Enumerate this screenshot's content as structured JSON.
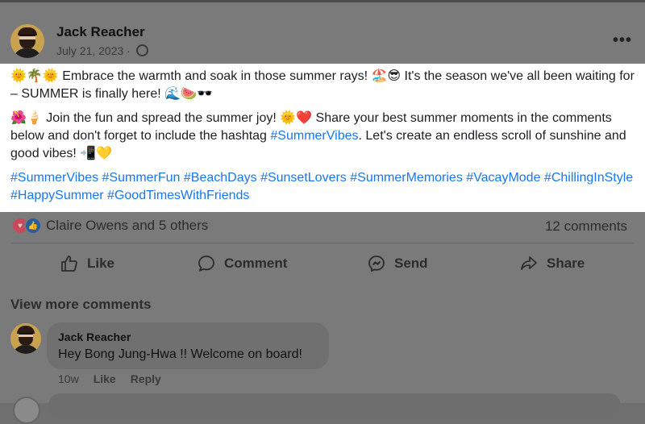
{
  "post": {
    "author": "Jack Reacher",
    "date": "July 21, 2023 ·",
    "more_label": "•••",
    "paragraph1": "🌞🌴🌞 Embrace the warmth and soak in those summer rays! 🏖️😎 It's the season we've all been waiting for – SUMMER is finally here! 🌊🍉🕶️",
    "paragraph2_text": "🌺🍦 Join the fun and spread the summer joy! 🌞❤️ Share your best summer moments in the comments below and don't forget to include the hashtag ",
    "paragraph2_tag": "#SummerVibes",
    "paragraph2_end": ". Let's create an endless scroll of sunshine and good vibes! 📲💛",
    "hashtags": "#SummerVibes #SummerFun #BeachDays #SunsetLovers #SummerMemories #VacayMode #ChillingInStyle #HappySummer #GoodTimesWithFriends"
  },
  "reactions": {
    "summary": "Claire Owens and 5 others",
    "comments_count": "12 comments"
  },
  "actions": {
    "like": "Like",
    "comment": "Comment",
    "send": "Send",
    "share": "Share"
  },
  "comments": {
    "view_more": "View more comments",
    "items": [
      {
        "author": "Jack Reacher",
        "text": "Hey Bong Jung-Hwa !! Welcome on board!",
        "time": "10w",
        "like": "Like",
        "reply": "Reply"
      }
    ]
  },
  "icons": {
    "globe": "globe-icon",
    "like": "thumbs-up-icon",
    "comment": "speech-bubble-icon",
    "send": "messenger-icon",
    "share": "share-arrow-icon",
    "more": "more-options-icon"
  },
  "colors": {
    "hashtag": "#1877f2",
    "background": "#ffffff",
    "dim_overlay": "#7a7a7a"
  }
}
